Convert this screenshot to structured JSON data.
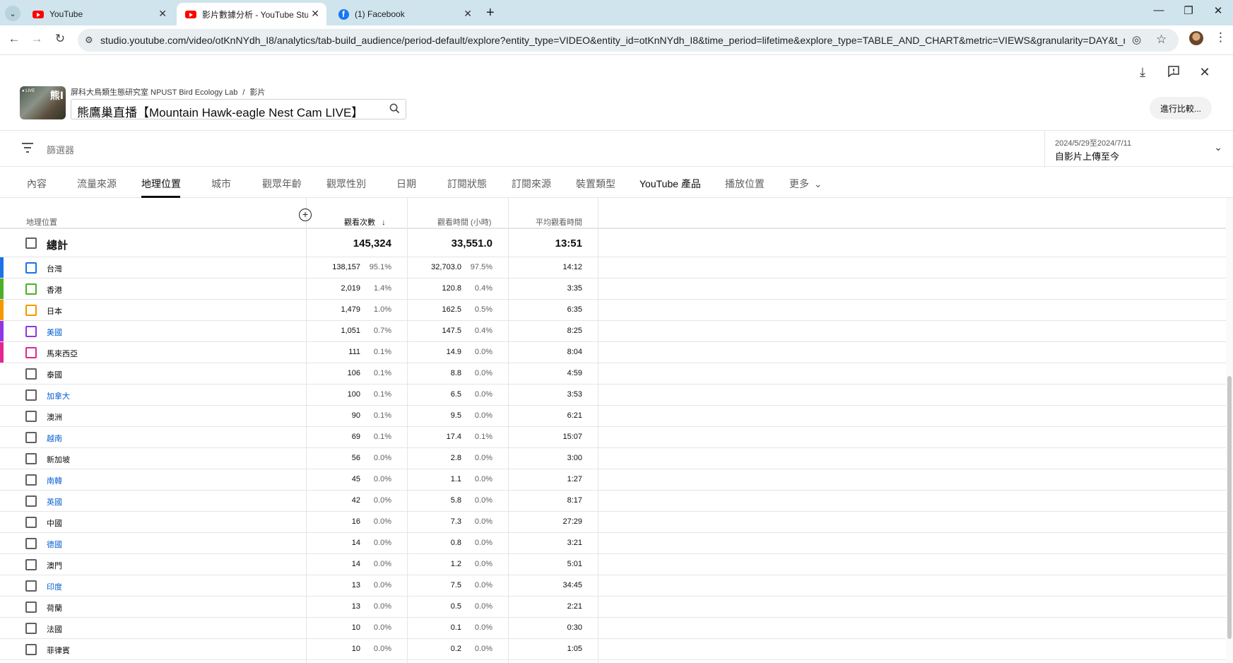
{
  "browser": {
    "tabs": [
      {
        "title": "YouTube",
        "favicon": "youtube-icon"
      },
      {
        "title": "影片數據分析 - YouTube Studio",
        "favicon": "youtube-icon"
      },
      {
        "title": "(1) Facebook",
        "favicon": "facebook-icon"
      }
    ],
    "url": "studio.youtube.com/video/otKnNYdh_I8/analytics/tab-build_audience/period-default/explore?entity_type=VIDEO&entity_id=otKnNYdh_I8&time_period=lifetime&explore_type=TABLE_AND_CHART&metric=VIEWS&granularity=DAY&t_metric..."
  },
  "header": {
    "thumbnail_text": "熊Ⅰ",
    "channel": "屏科大鳥類生態研究室 NPUST Bird Ecology Lab",
    "breadcrumb_sep": "/",
    "breadcrumb_page": "影片",
    "video_title": "熊鷹巢直播【Mountain Hawk-eagle Nest Cam LIVE】",
    "compare_button": "進行比較..."
  },
  "filter": {
    "placeholder": "篩選器",
    "date_range": "2024/5/29至2024/7/11",
    "date_label": "自影片上傳至今"
  },
  "tabs": [
    "內容",
    "流量來源",
    "地理位置",
    "城市",
    "觀眾年齡",
    "觀眾性別",
    "日期",
    "訂閱狀態",
    "訂閱來源",
    "裝置類型",
    "YouTube 產品",
    "播放位置",
    "更多"
  ],
  "selected_tab": "地理位置",
  "table": {
    "headers": {
      "dimension": "地理位置",
      "views": "觀看次數",
      "watch_time": "觀看時間 (小時)",
      "avg_view": "平均觀看時間"
    },
    "total": {
      "label": "總計",
      "views": "145,324",
      "watch_time": "33,551.0",
      "avg_view": "13:51"
    },
    "rows": [
      {
        "name": "台灣",
        "link": false,
        "color": "#1a73e8",
        "views": "138,157",
        "views_pct": "95.1%",
        "time": "32,703.0",
        "time_pct": "97.5%",
        "avg": "14:12"
      },
      {
        "name": "香港",
        "link": false,
        "color": "#4caf29",
        "views": "2,019",
        "views_pct": "1.4%",
        "time": "120.8",
        "time_pct": "0.4%",
        "avg": "3:35"
      },
      {
        "name": "日本",
        "link": false,
        "color": "#f29900",
        "views": "1,479",
        "views_pct": "1.0%",
        "time": "162.5",
        "time_pct": "0.5%",
        "avg": "6:35"
      },
      {
        "name": "美國",
        "link": true,
        "color": "#9334e6",
        "views": "1,051",
        "views_pct": "0.7%",
        "time": "147.5",
        "time_pct": "0.4%",
        "avg": "8:25"
      },
      {
        "name": "馬來西亞",
        "link": false,
        "color": "#e52592",
        "views": "111",
        "views_pct": "0.1%",
        "time": "14.9",
        "time_pct": "0.0%",
        "avg": "8:04"
      },
      {
        "name": "泰國",
        "link": false,
        "color": "",
        "views": "106",
        "views_pct": "0.1%",
        "time": "8.8",
        "time_pct": "0.0%",
        "avg": "4:59"
      },
      {
        "name": "加拿大",
        "link": true,
        "color": "",
        "views": "100",
        "views_pct": "0.1%",
        "time": "6.5",
        "time_pct": "0.0%",
        "avg": "3:53"
      },
      {
        "name": "澳洲",
        "link": false,
        "color": "",
        "views": "90",
        "views_pct": "0.1%",
        "time": "9.5",
        "time_pct": "0.0%",
        "avg": "6:21"
      },
      {
        "name": "越南",
        "link": true,
        "color": "",
        "views": "69",
        "views_pct": "0.1%",
        "time": "17.4",
        "time_pct": "0.1%",
        "avg": "15:07"
      },
      {
        "name": "新加坡",
        "link": false,
        "color": "",
        "views": "56",
        "views_pct": "0.0%",
        "time": "2.8",
        "time_pct": "0.0%",
        "avg": "3:00"
      },
      {
        "name": "南韓",
        "link": true,
        "color": "",
        "views": "45",
        "views_pct": "0.0%",
        "time": "1.1",
        "time_pct": "0.0%",
        "avg": "1:27"
      },
      {
        "name": "英國",
        "link": true,
        "color": "",
        "views": "42",
        "views_pct": "0.0%",
        "time": "5.8",
        "time_pct": "0.0%",
        "avg": "8:17"
      },
      {
        "name": "中國",
        "link": false,
        "color": "",
        "views": "16",
        "views_pct": "0.0%",
        "time": "7.3",
        "time_pct": "0.0%",
        "avg": "27:29"
      },
      {
        "name": "德國",
        "link": true,
        "color": "",
        "views": "14",
        "views_pct": "0.0%",
        "time": "0.8",
        "time_pct": "0.0%",
        "avg": "3:21"
      },
      {
        "name": "澳門",
        "link": false,
        "color": "",
        "views": "14",
        "views_pct": "0.0%",
        "time": "1.2",
        "time_pct": "0.0%",
        "avg": "5:01"
      },
      {
        "name": "印度",
        "link": true,
        "color": "",
        "views": "13",
        "views_pct": "0.0%",
        "time": "7.5",
        "time_pct": "0.0%",
        "avg": "34:45"
      },
      {
        "name": "荷蘭",
        "link": false,
        "color": "",
        "views": "13",
        "views_pct": "0.0%",
        "time": "0.5",
        "time_pct": "0.0%",
        "avg": "2:21"
      },
      {
        "name": "法國",
        "link": false,
        "color": "",
        "views": "10",
        "views_pct": "0.0%",
        "time": "0.1",
        "time_pct": "0.0%",
        "avg": "0:30"
      },
      {
        "name": "菲律賓",
        "link": false,
        "color": "",
        "views": "10",
        "views_pct": "0.0%",
        "time": "0.2",
        "time_pct": "0.0%",
        "avg": "1:05"
      }
    ]
  }
}
